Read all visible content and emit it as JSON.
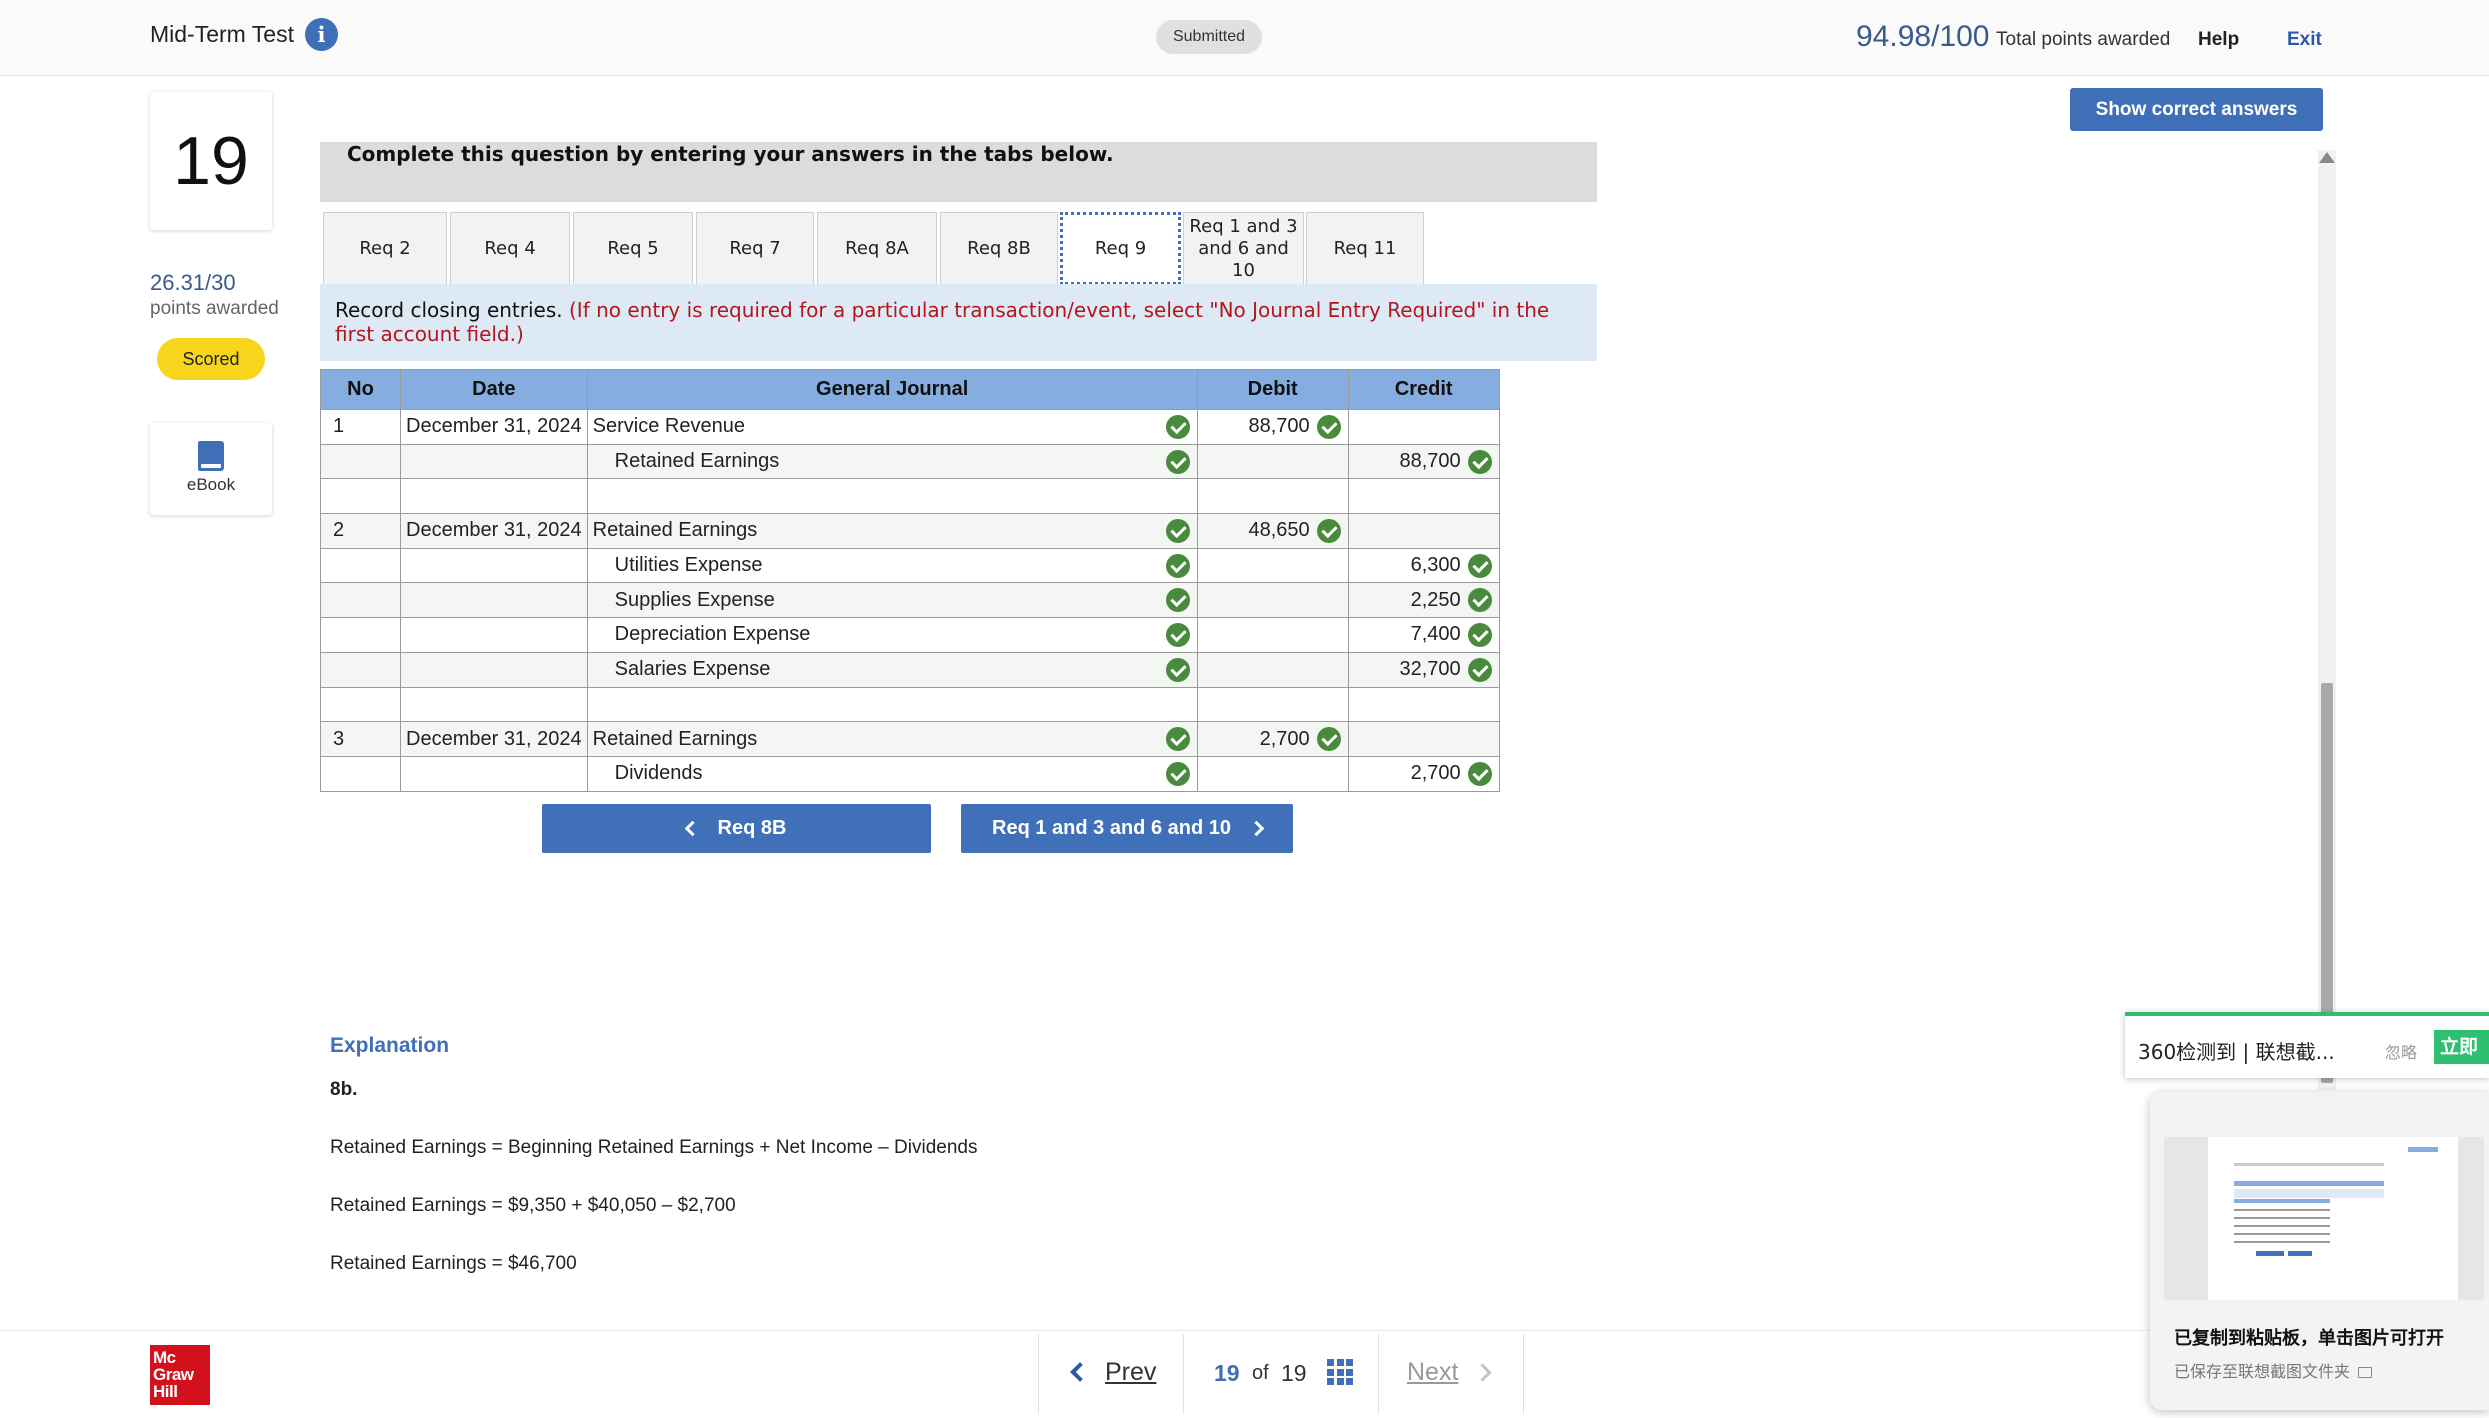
{
  "header": {
    "title": "Mid-Term Test",
    "info_icon_glyph": "i",
    "status_badge": "Submitted",
    "total_score": "94.98/100",
    "total_label": "Total points awarded",
    "help_label": "Help",
    "exit_label": "Exit"
  },
  "sidebar": {
    "question_number": "19",
    "score": "26.31/30",
    "score_label": "points awarded",
    "scored_badge": "Scored",
    "ebook_label": "eBook"
  },
  "show_answers_label": "Show correct answers",
  "instructions": "Complete this question by entering your answers in the tabs below.",
  "tabs": [
    {
      "label": "Req 2"
    },
    {
      "label": "Req 4"
    },
    {
      "label": "Req 5"
    },
    {
      "label": "Req 7"
    },
    {
      "label": "Req 8A"
    },
    {
      "label": "Req 8B"
    },
    {
      "label": "Req 9",
      "active": true
    },
    {
      "label_lines": [
        "Req 1 and 3",
        "and 6 and",
        "10"
      ]
    },
    {
      "label": "Req 11"
    }
  ],
  "requirement": {
    "text": "Record closing entries.",
    "note": "(If no entry is required for a particular transaction/event, select \"No Journal Entry Required\" in the first account field.)"
  },
  "journal": {
    "headers": [
      "No",
      "Date",
      "General Journal",
      "Debit",
      "Credit"
    ],
    "rows": [
      {
        "no": "1",
        "date": "December 31, 2024",
        "account": "Service Revenue",
        "debit": "88,700",
        "credit": "",
        "indent": false,
        "acct_check": true
      },
      {
        "no": "",
        "date": "",
        "account": "Retained Earnings",
        "debit": "",
        "credit": "88,700",
        "indent": true,
        "acct_check": true
      },
      {
        "no": "",
        "date": "",
        "account": "",
        "debit": "",
        "credit": "",
        "indent": false,
        "acct_check": false
      },
      {
        "no": "2",
        "date": "December 31, 2024",
        "account": "Retained Earnings",
        "debit": "48,650",
        "credit": "",
        "indent": false,
        "acct_check": true
      },
      {
        "no": "",
        "date": "",
        "account": "Utilities Expense",
        "debit": "",
        "credit": "6,300",
        "indent": true,
        "acct_check": true
      },
      {
        "no": "",
        "date": "",
        "account": "Supplies Expense",
        "debit": "",
        "credit": "2,250",
        "indent": true,
        "acct_check": true
      },
      {
        "no": "",
        "date": "",
        "account": "Depreciation Expense",
        "debit": "",
        "credit": "7,400",
        "indent": true,
        "acct_check": true
      },
      {
        "no": "",
        "date": "",
        "account": "Salaries Expense",
        "debit": "",
        "credit": "32,700",
        "indent": true,
        "acct_check": true
      },
      {
        "no": "",
        "date": "",
        "account": "",
        "debit": "",
        "credit": "",
        "indent": false,
        "acct_check": false
      },
      {
        "no": "3",
        "date": "December 31, 2024",
        "account": "Retained Earnings",
        "debit": "2,700",
        "credit": "",
        "indent": false,
        "acct_check": true
      },
      {
        "no": "",
        "date": "",
        "account": "Dividends",
        "debit": "",
        "credit": "2,700",
        "indent": true,
        "acct_check": true
      }
    ]
  },
  "nav": {
    "prev_tab_label": "Req 8B",
    "next_tab_label": "Req 1 and 3 and 6 and 10"
  },
  "explanation": {
    "title": "Explanation",
    "subtitle": "8b.",
    "lines": [
      "Retained Earnings = Beginning Retained Earnings + Net Income – Dividends",
      "Retained Earnings = $9,350 + $40,050 – $2,700",
      "Retained Earnings = $46,700"
    ]
  },
  "footer": {
    "logo_lines": [
      "Mc",
      "Graw",
      "Hill"
    ],
    "prev_label": "Prev",
    "current_page": "19",
    "of_label": "of",
    "total_pages": "19",
    "next_label": "Next"
  },
  "notification": {
    "text": "360检测到 | 联想截...",
    "ignore_label": "忽略",
    "open_label": "立即"
  },
  "toast": {
    "title": "已复制到粘贴板，单击图片可打开",
    "subtitle": "已保存至联想截图文件夹"
  },
  "colors": {
    "accent": "#3f6fb6",
    "table_header": "#85ade0",
    "correct_check": "#4a8a3c",
    "scored_badge": "#f7d51c",
    "requirement_note": "#b4161b",
    "logo_red": "#d3111c"
  },
  "icons": [
    "info-icon",
    "ebook-icon",
    "check-icon",
    "chevron-left-icon",
    "chevron-right-icon",
    "grid-icon",
    "folder-icon"
  ]
}
